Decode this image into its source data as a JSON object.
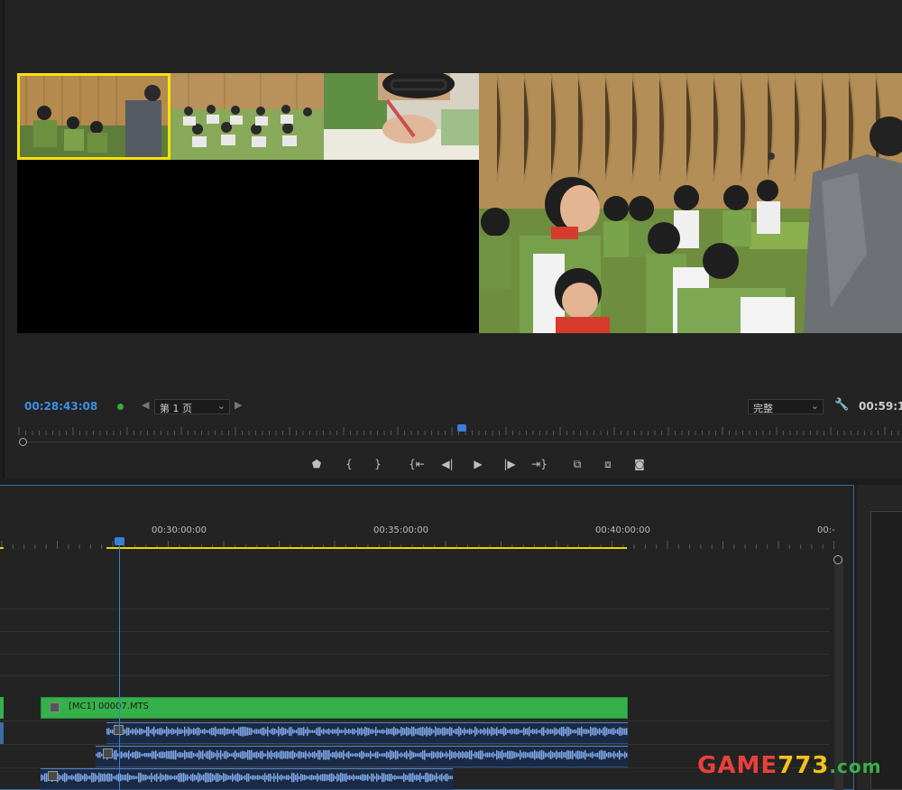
{
  "monitor": {
    "timecode_current": "00:28:43:08",
    "page_select": "第 1 页",
    "quality_select": "完整",
    "timecode_duration": "00:59:1"
  },
  "timeline": {
    "ruler_labels": [
      "00:30:00:00",
      "00:35:00:00",
      "00:40:00:00",
      "00:-"
    ],
    "video_clip_name": "[MC1] 00007.MTS"
  },
  "watermark": {
    "part1": "GAME",
    "part2": "773",
    "part3": ".com"
  },
  "colors": {
    "accent_timecode": "#3e8fe6",
    "active_camera_border": "#f5e30c",
    "video_clip": "#36b04a",
    "audio_clip": "#5c86c9",
    "playhead": "#3a7fd8"
  }
}
